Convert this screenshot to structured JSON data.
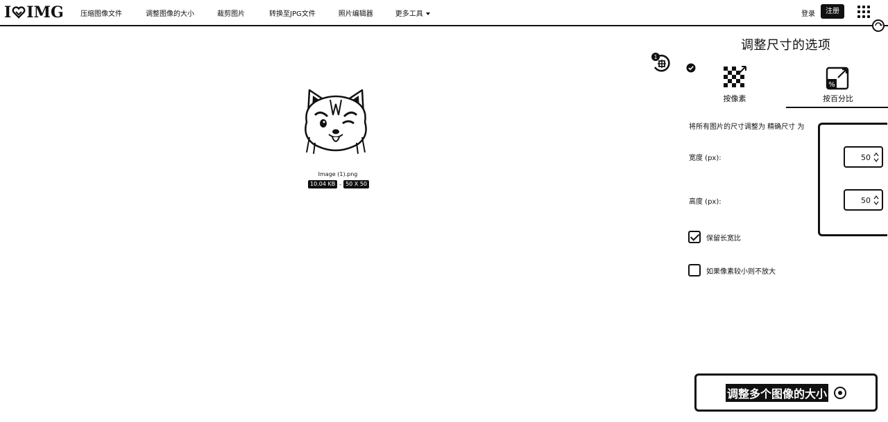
{
  "header": {
    "logo_text_left": "I",
    "logo_text_right": "IMG",
    "nav": [
      {
        "label": "压缩图像文件"
      },
      {
        "label": "调整图像的大小"
      },
      {
        "label": "裁剪图片"
      },
      {
        "label": "转换至JPG文件"
      },
      {
        "label": "照片编辑器"
      },
      {
        "label": "更多工具"
      }
    ],
    "login": "登录",
    "register": "注册"
  },
  "workspace": {
    "file_name": "Image (1).png",
    "file_size": "10.04 KB",
    "sep": "-",
    "dimensions": "50 X 50",
    "rotate_badge": "1"
  },
  "sidebar": {
    "title": "调整尺寸的选项",
    "options": [
      {
        "label": "按像素"
      },
      {
        "label": "按百分比"
      }
    ],
    "description": "将所有图片的尺寸调整为 精确尺寸 为",
    "width_label": "宽度 (px):",
    "width_value": "50",
    "height_label": "高度 (px):",
    "height_value": "50",
    "keep_ratio_label": "保留长宽比",
    "keep_ratio_checked": true,
    "no_enlarge_label": "如果像素较小则不放大",
    "no_enlarge_checked": false,
    "submit_label": "调整多个图像的大小"
  }
}
